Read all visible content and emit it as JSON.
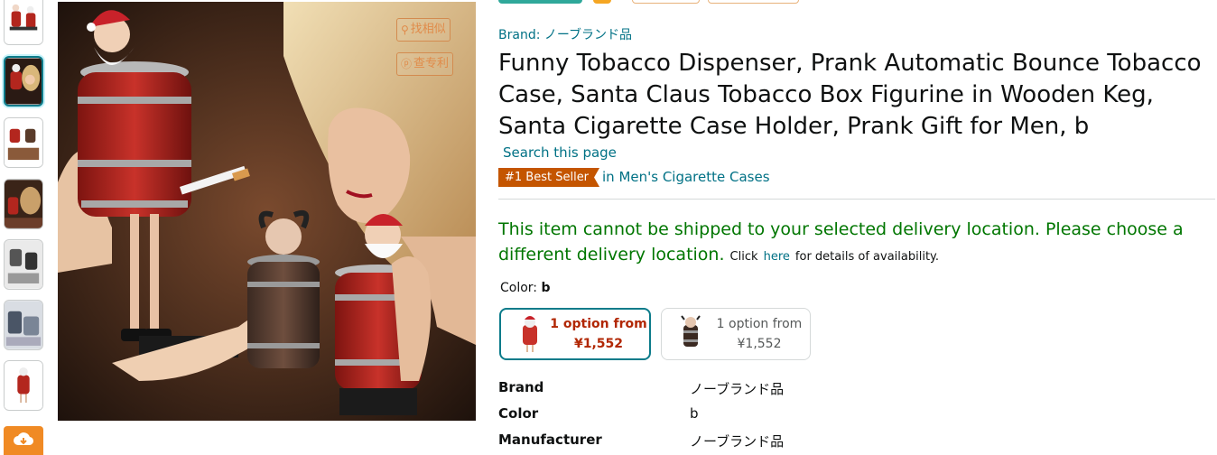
{
  "gallery": {
    "thumbnails": [
      "thumb-1",
      "thumb-2",
      "thumb-3",
      "thumb-4",
      "thumb-5",
      "thumb-6",
      "thumb-7"
    ],
    "selected_index": 1,
    "download_icon": "cloud-download-icon"
  },
  "main_image": {
    "tags": [
      {
        "icon": "search-icon",
        "label": "找相似"
      },
      {
        "icon": "patent-icon",
        "label": "查专利"
      }
    ]
  },
  "product": {
    "brand_line": "Brand: ノーブランド品",
    "title": "Funny Tobacco Dispenser, Prank Automatic Bounce Tobacco Case, Santa Claus Tobacco Box Figurine in Wooden Keg, Santa Cigarette Case Holder, Prank Gift for Men, b",
    "search_page": "Search this page",
    "best_seller_badge": "#1 Best Seller",
    "best_seller_category": "in Men's Cigarette Cases"
  },
  "shipping": {
    "message": "This item cannot be shipped to your selected delivery location. Please choose a different delivery location.",
    "click_text": "Click",
    "here_link": "here",
    "details_text": "for details of availability."
  },
  "variation": {
    "label": "Color:",
    "selected_value": "b",
    "options": [
      {
        "line1": "1 option from",
        "line2": "¥1,552",
        "selected": true
      },
      {
        "line1": "1 option from",
        "line2": "¥1,552",
        "selected": false
      }
    ]
  },
  "specs": [
    {
      "key": "Brand",
      "value": "ノーブランド品"
    },
    {
      "key": "Color",
      "value": "b"
    },
    {
      "key": "Manufacturer",
      "value": "ノーブランド品"
    }
  ],
  "colors": {
    "link": "#007185",
    "ship_green": "#007600",
    "badge_orange": "#c45500",
    "price_red": "#b12704",
    "selected_teal": "#0b7b8a"
  }
}
